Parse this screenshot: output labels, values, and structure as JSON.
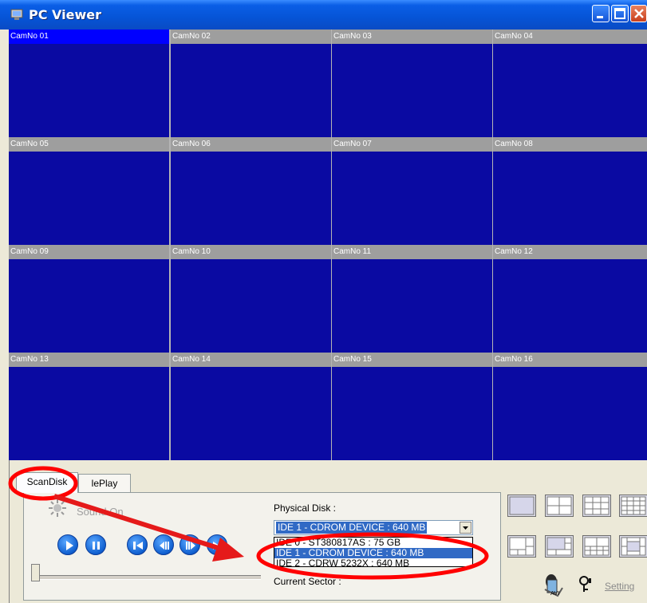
{
  "window": {
    "title": "PC Viewer"
  },
  "cameras": [
    "CamNo 01",
    "CamNo 02",
    "CamNo 03",
    "CamNo 04",
    "CamNo 05",
    "CamNo 06",
    "CamNo 07",
    "CamNo 08",
    "CamNo 09",
    "CamNo 10",
    "CamNo 11",
    "CamNo 12",
    "CamNo 13",
    "CamNo 14",
    "CamNo 15",
    "CamNo 16"
  ],
  "tabs": {
    "scandisk": "ScanDisk",
    "fileplay": "lePlay"
  },
  "sound": {
    "label": "Sound On"
  },
  "physical_disk": {
    "label": "Physical Disk :",
    "selected": "IDE 1 - CDROM DEVICE : 640 MB",
    "options": [
      "IDE 0 - ST380817AS : 75 GB",
      "IDE 1 - CDROM DEVICE : 640 MB",
      "IDE 2 - CDRW 5232X : 640 MB"
    ],
    "selected_index": 1
  },
  "current_sector": {
    "label": "Current Sector :"
  },
  "setting": {
    "label": "Setting"
  },
  "colors": {
    "title_bar": "#0654d6",
    "camera_view": "#0a0aa2",
    "active_header": "#0000ff",
    "highlight": "#ff0000"
  },
  "icons": [
    "app-icon",
    "minimize-icon",
    "maximize-icon",
    "close-icon",
    "sound-icon",
    "play-icon",
    "pause-icon",
    "skip-back-icon",
    "step-back-icon",
    "step-forward-icon",
    "skip-forward-icon",
    "avi-icon",
    "key-icon"
  ]
}
